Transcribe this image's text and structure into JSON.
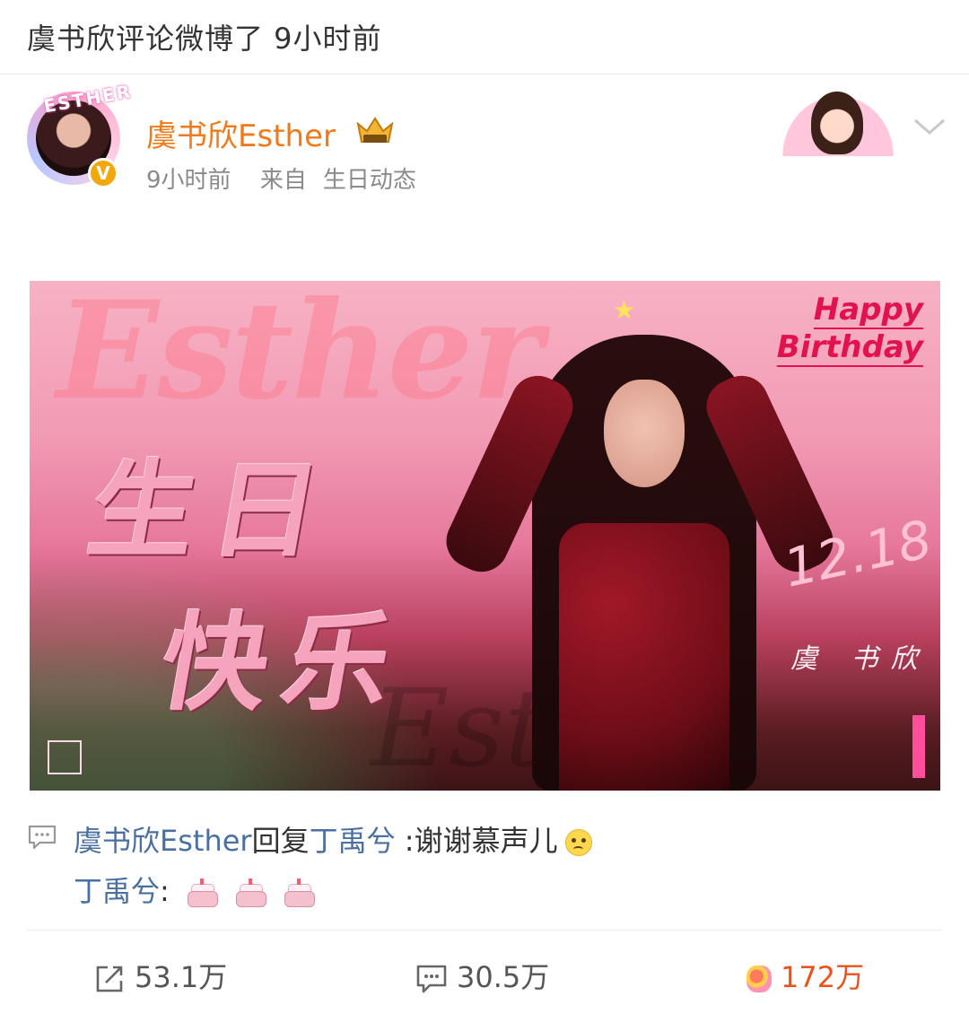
{
  "top_bar": {
    "text": "虞书欣评论微博了 9小时前"
  },
  "post": {
    "author": "虞书欣Esther",
    "verified_badge": "V",
    "time": "9小时前",
    "source_prefix": "来自",
    "source": "生日动态",
    "avatar_text": "ESTHER"
  },
  "banner": {
    "bg_word": "Esther",
    "bg_word_2": "Esther",
    "line1": "生日",
    "line2": "快乐",
    "happy": "Happy",
    "birthday": "Birthday",
    "date": "12.18",
    "name": "虞 书欣"
  },
  "reply": {
    "from": "虞书欣Esther",
    "verb": "回复",
    "to": "丁禹兮",
    "text": ":谢谢慕声儿",
    "emoji": "sad-face-icon",
    "second_user": "丁禹兮",
    "second_sep": ":",
    "second_emoji": "cake-icon x3"
  },
  "actions": {
    "repost_count": "53.1万",
    "comment_count": "30.5万",
    "like_count": "172万"
  },
  "colors": {
    "username": "#f07a1a",
    "link_blue": "#4a6fa1",
    "like_orange": "#e8541c",
    "meta_gray": "#8a8a8a"
  }
}
